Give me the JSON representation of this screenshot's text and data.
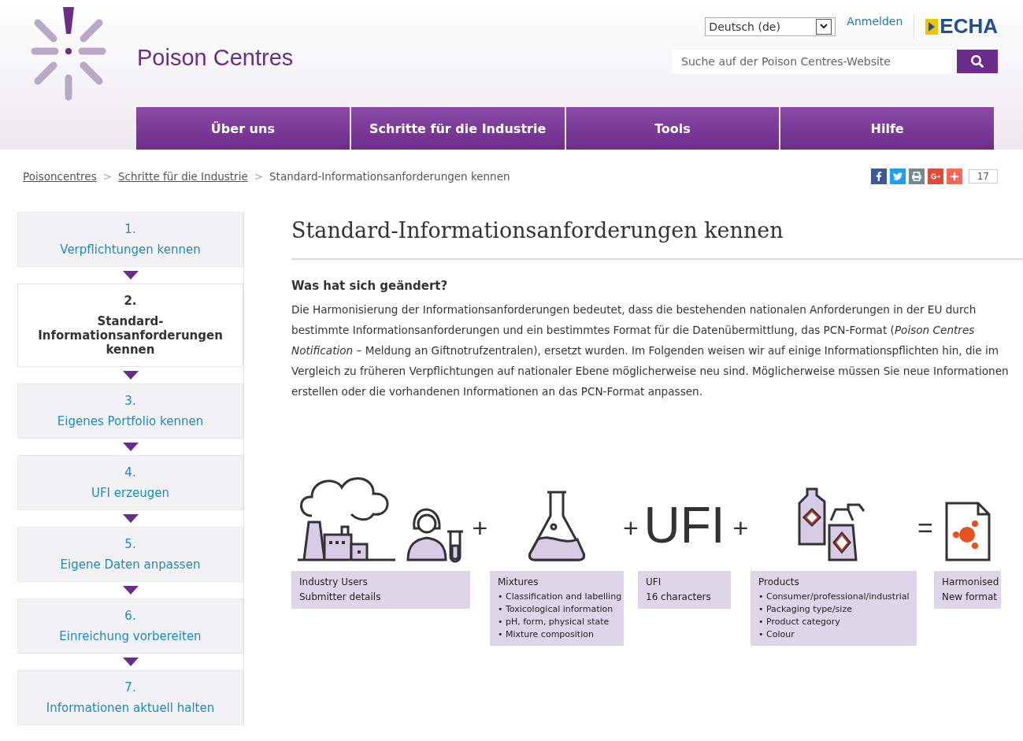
{
  "header": {
    "site_title": "Poison Centres",
    "language": "Deutsch (de)",
    "login": "Anmelden",
    "brand": "ECHA",
    "search": {
      "placeholder": "Suche auf der Poison Centres-Website"
    }
  },
  "nav": [
    {
      "label": "Über uns"
    },
    {
      "label": "Schritte für die Industrie"
    },
    {
      "label": "Tools"
    },
    {
      "label": "Hilfe"
    }
  ],
  "breadcrumb": [
    {
      "kind": "crumb",
      "label": "Poisoncentres",
      "link": true
    },
    {
      "kind": "separator",
      "label": ">"
    },
    {
      "kind": "crumb",
      "label": "Schritte für die Industrie",
      "link": true
    },
    {
      "kind": "separator",
      "label": ">"
    },
    {
      "kind": "crumb",
      "label": "Standard-Informationsanforderungen kennen",
      "link": false
    }
  ],
  "share": {
    "count": "17"
  },
  "sidebar": [
    {
      "number": "1.",
      "label": "Verpflichtungen kennen",
      "selected": false
    },
    {
      "number": "2.",
      "label": "Standard-Informationsanforderungen kennen",
      "selected": true
    },
    {
      "number": "3.",
      "label": "Eigenes Portfolio kennen",
      "selected": false
    },
    {
      "number": "4.",
      "label": "UFI erzeugen",
      "selected": false
    },
    {
      "number": "5.",
      "label": "Eigene Daten anpassen",
      "selected": false
    },
    {
      "number": "6.",
      "label": "Einreichung vorbereiten",
      "selected": false
    },
    {
      "number": "7.",
      "label": "Informationen aktuell halten",
      "selected": false
    }
  ],
  "title": "Standard-Informationsanforderungen kennen",
  "heading": "Was hat sich geändert?",
  "paragraph": "Die Harmonisierung der Informationsanforderungen bedeutet, dass die bestehenden nationalen Anforderungen in der EU durch bestimmte Informationsanforderungen und ein bestimmtes Format für die Datenübermittlung, das PCN-Format (*Poison Centres Notification* – Meldung an Giftnotrufzentralen), ersetzt wurden. Im Folgenden weisen wir auf einige Informationspflichten hin, die im Vergleich zu früheren Verpflichtungen auf nationaler Ebene möglicherweise neu sind. Möglicherweise müssen Sie neue Informationen erstellen oder die vorhandenen Informationen an das PCN-Format anpassen.",
  "diagram": [
    {
      "kind": "block",
      "title": "Industry Users",
      "lines": [
        "Submitter details"
      ]
    },
    {
      "kind": "operator",
      "text": "+"
    },
    {
      "kind": "block",
      "title": "Mixtures",
      "bullets": [
        "• Classification and labelling",
        "• Toxicological information",
        "• pH, form, physical state",
        "• Mixture composition"
      ]
    },
    {
      "kind": "operator",
      "text": "+"
    },
    {
      "kind": "block",
      "label": "UFI",
      "title": "UFI",
      "lines": [
        "16 characters"
      ]
    },
    {
      "kind": "operator",
      "text": "+"
    },
    {
      "kind": "block",
      "title": "Products",
      "bullets": [
        "• Consumer/professional/industrial",
        "• Packaging type/size",
        "• Product category",
        "• Colour"
      ]
    },
    {
      "kind": "operator",
      "text": "="
    },
    {
      "kind": "block",
      "title": "Harmonised",
      "lines": [
        "New format"
      ]
    }
  ]
}
